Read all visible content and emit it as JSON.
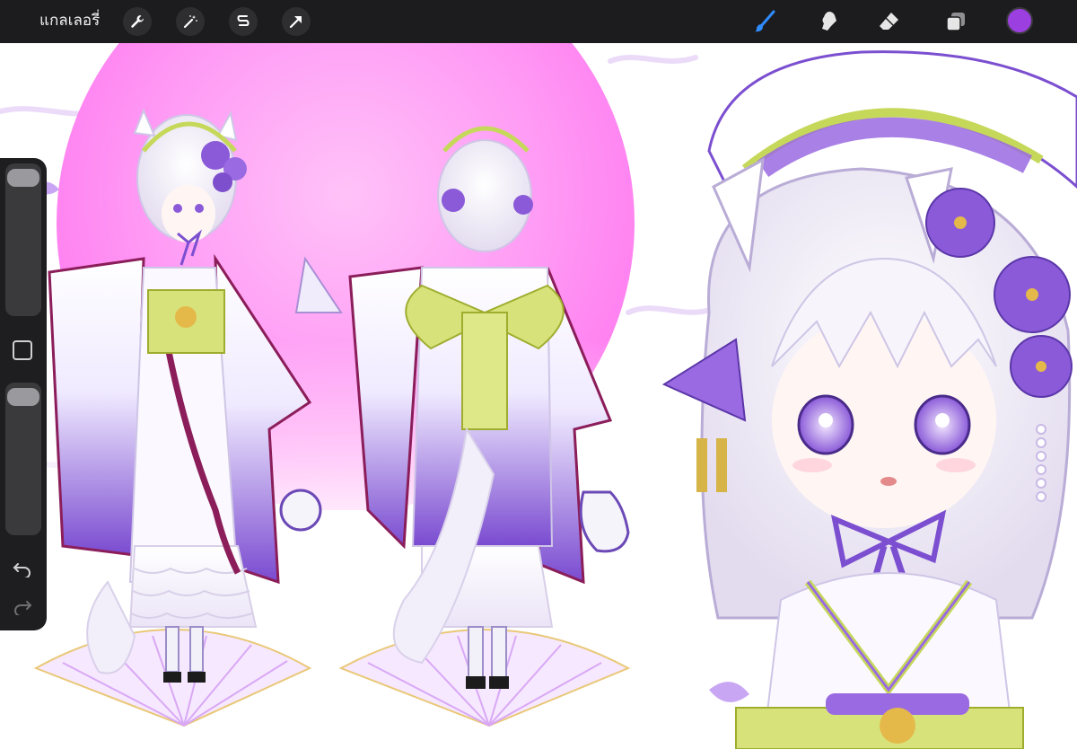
{
  "toolbar": {
    "gallery_label": "แกลเลอรี่",
    "left_tools": [
      "wrench-icon",
      "magic-wand-icon",
      "selection-icon",
      "transform-arrow-icon"
    ],
    "right_tools": [
      "brush-icon",
      "smudge-icon",
      "eraser-icon",
      "layers-icon"
    ],
    "active_tool": "brush-icon",
    "active_color": "#9b3fe0"
  },
  "sidebar": {
    "brush_size_level": 0.95,
    "opacity_level": 0.95,
    "icons": [
      "modify-square-icon",
      "undo-icon",
      "redo-icon"
    ]
  },
  "colors": {
    "toolbar_bg": "#1c1c1e",
    "brush_active": "#2f8cff",
    "moon_pink": "#ff7ef0",
    "kimono_purple": "#8a5ad8",
    "obi_green": "#c8d94a",
    "hair_white": "#f4f1fa"
  }
}
